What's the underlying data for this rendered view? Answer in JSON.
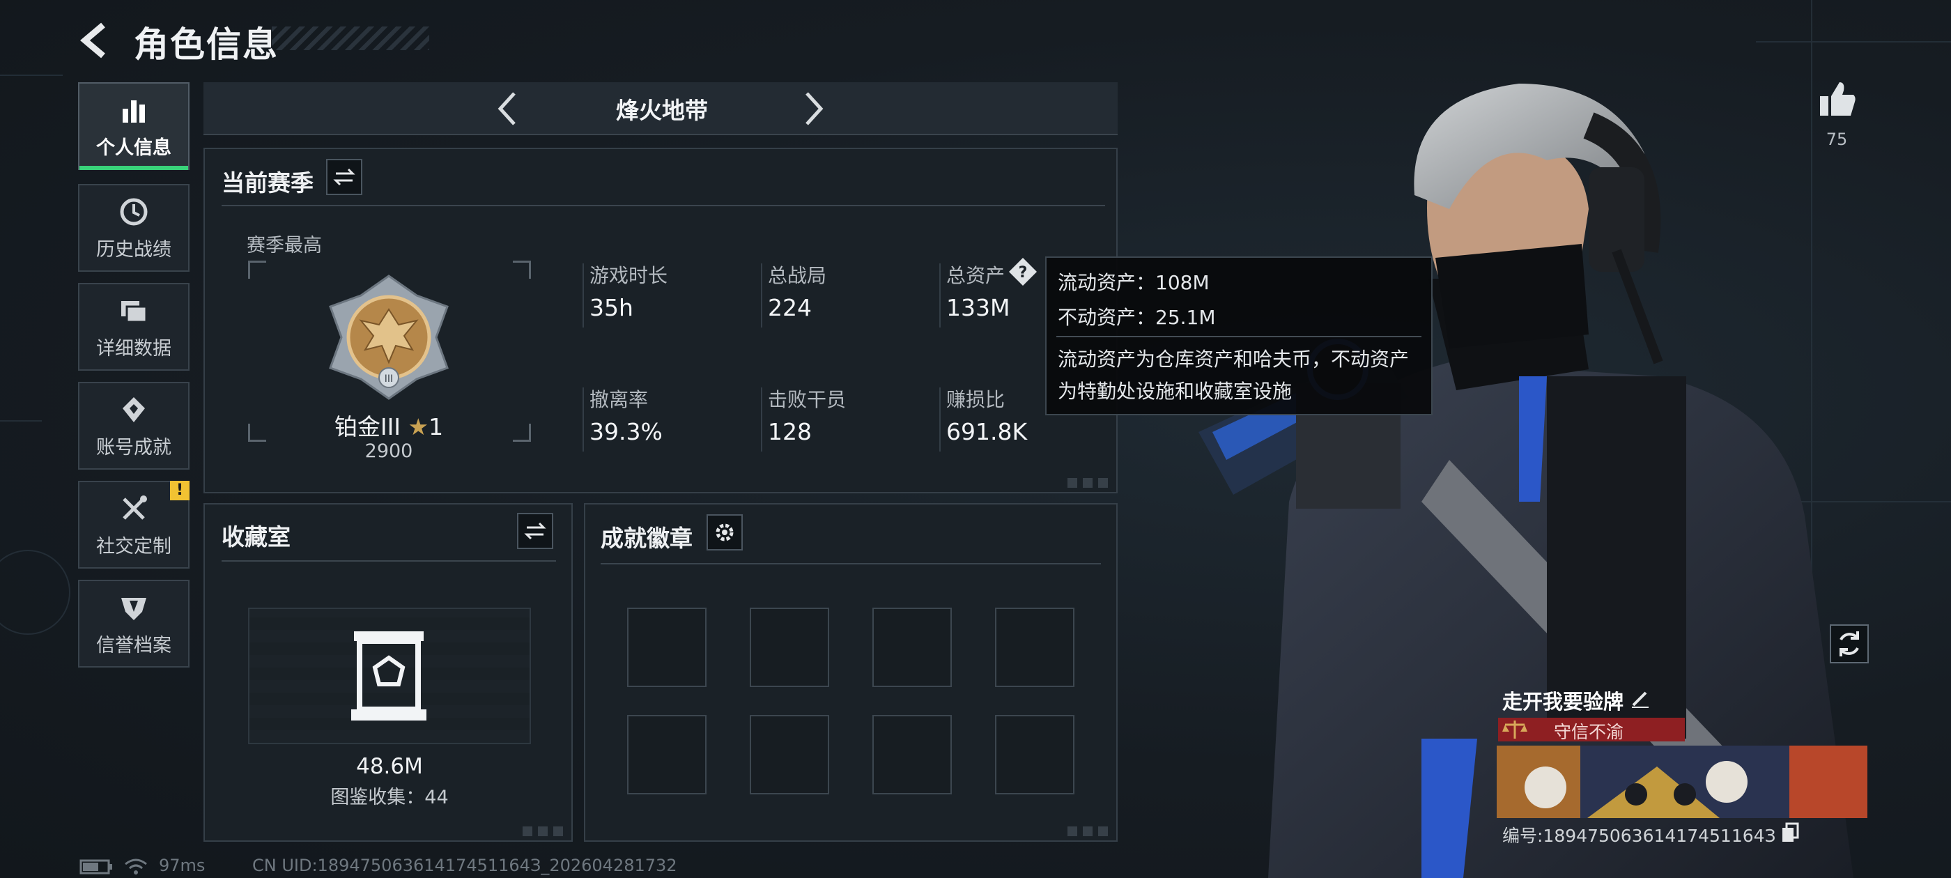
{
  "header": {
    "title": "角色信息"
  },
  "sidebar": {
    "items": [
      {
        "label": "个人信息",
        "icon": "bar-chart-icon",
        "active": true
      },
      {
        "label": "历史战绩",
        "icon": "history-clock-icon"
      },
      {
        "label": "详细数据",
        "icon": "folder-icon"
      },
      {
        "label": "账号成就",
        "icon": "diamond-medal-icon"
      },
      {
        "label": "社交定制",
        "icon": "tools-icon",
        "badge": "!"
      },
      {
        "label": "信誉档案",
        "icon": "shield-emblem-icon"
      }
    ]
  },
  "mode": {
    "label": "烽火地带"
  },
  "season": {
    "title": "当前赛季",
    "best_label": "赛季最高",
    "rank_name": "铂金III",
    "rank_stars": "1",
    "rank_score": "2900",
    "stats": [
      {
        "label": "游戏时长",
        "value": "35h"
      },
      {
        "label": "总战局",
        "value": "224"
      },
      {
        "label": "总资产",
        "value": "133M"
      },
      {
        "label": "撤离率",
        "value": "39.3%"
      },
      {
        "label": "击败干员",
        "value": "128"
      },
      {
        "label": "赚损比",
        "value": "691.8K"
      }
    ]
  },
  "tooltip": {
    "line1": "流动资产：108M",
    "line2": "不动资产：25.1M",
    "line3": "流动资产为仓库资产和哈夫币，不动资产",
    "line4": "为特勤处设施和收藏室设施"
  },
  "collection": {
    "title": "收藏室",
    "value": "48.6M",
    "count_text": "图鉴收集：44"
  },
  "achievements": {
    "title": "成就徽章"
  },
  "profile": {
    "likes": "75",
    "name": "走开我要验牌",
    "title_tag": "守信不渝",
    "id_text": "编号:18947506361417451164З"
  },
  "footer": {
    "ping": "97ms",
    "uid": "CN UID:18947506361417451164З_202604281732"
  },
  "colors": {
    "accent": "#39d37a",
    "warning": "#f1c232",
    "title_red": "#8e1f22"
  }
}
